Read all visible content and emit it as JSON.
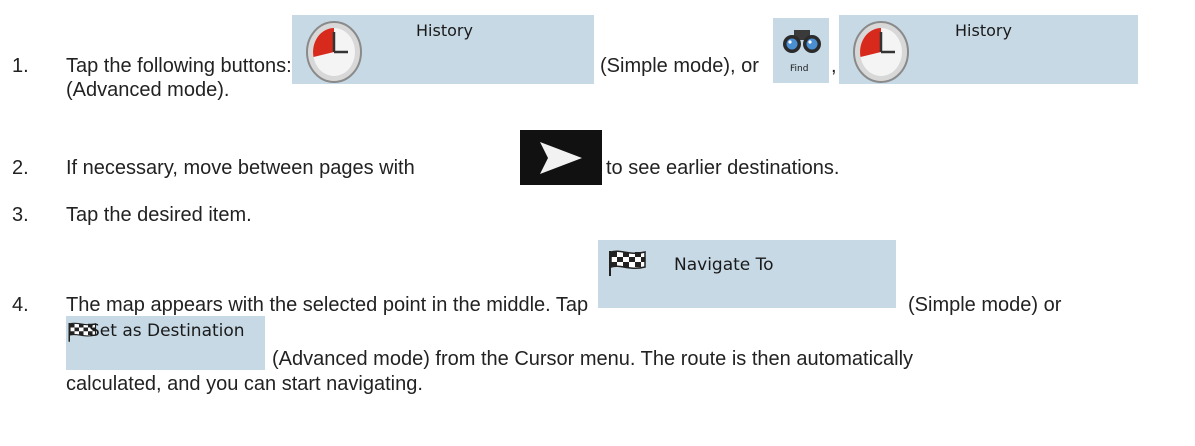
{
  "steps": [
    {
      "number": "1.",
      "text_a": "Tap the following buttons:",
      "text_b": "(Simple mode), or",
      "text_c": ",",
      "text_d": "(Advanced mode)."
    },
    {
      "number": "2.",
      "text_a": "If necessary, move between pages with",
      "text_b": "to see earlier destinations."
    },
    {
      "number": "3.",
      "text_a": "Tap the desired item."
    },
    {
      "number": "4.",
      "text_a": "The map appears with the selected point in the middle. Tap",
      "text_b": "(Simple mode) or",
      "text_c": "(Advanced mode) from the Cursor menu. The route is then automatically",
      "text_d": "calculated, and you can start navigating."
    }
  ],
  "buttons": {
    "history_simple": {
      "label": "History",
      "icon": "clock-icon"
    },
    "find": {
      "label": "Find",
      "icon": "binoculars-icon"
    },
    "history_advanced": {
      "label": "History",
      "icon": "clock-icon"
    },
    "next_page": {
      "icon": "arrow-right-icon"
    },
    "navigate_to": {
      "label": "Navigate To",
      "icon": "checkered-flag-icon"
    },
    "set_as_destination": {
      "label": "Set as Destination",
      "icon": "checkered-flag-icon"
    }
  },
  "colors": {
    "button_bg": "#c7d9e5",
    "arrow_button_bg": "#111111",
    "clock_red": "#d8291d"
  }
}
